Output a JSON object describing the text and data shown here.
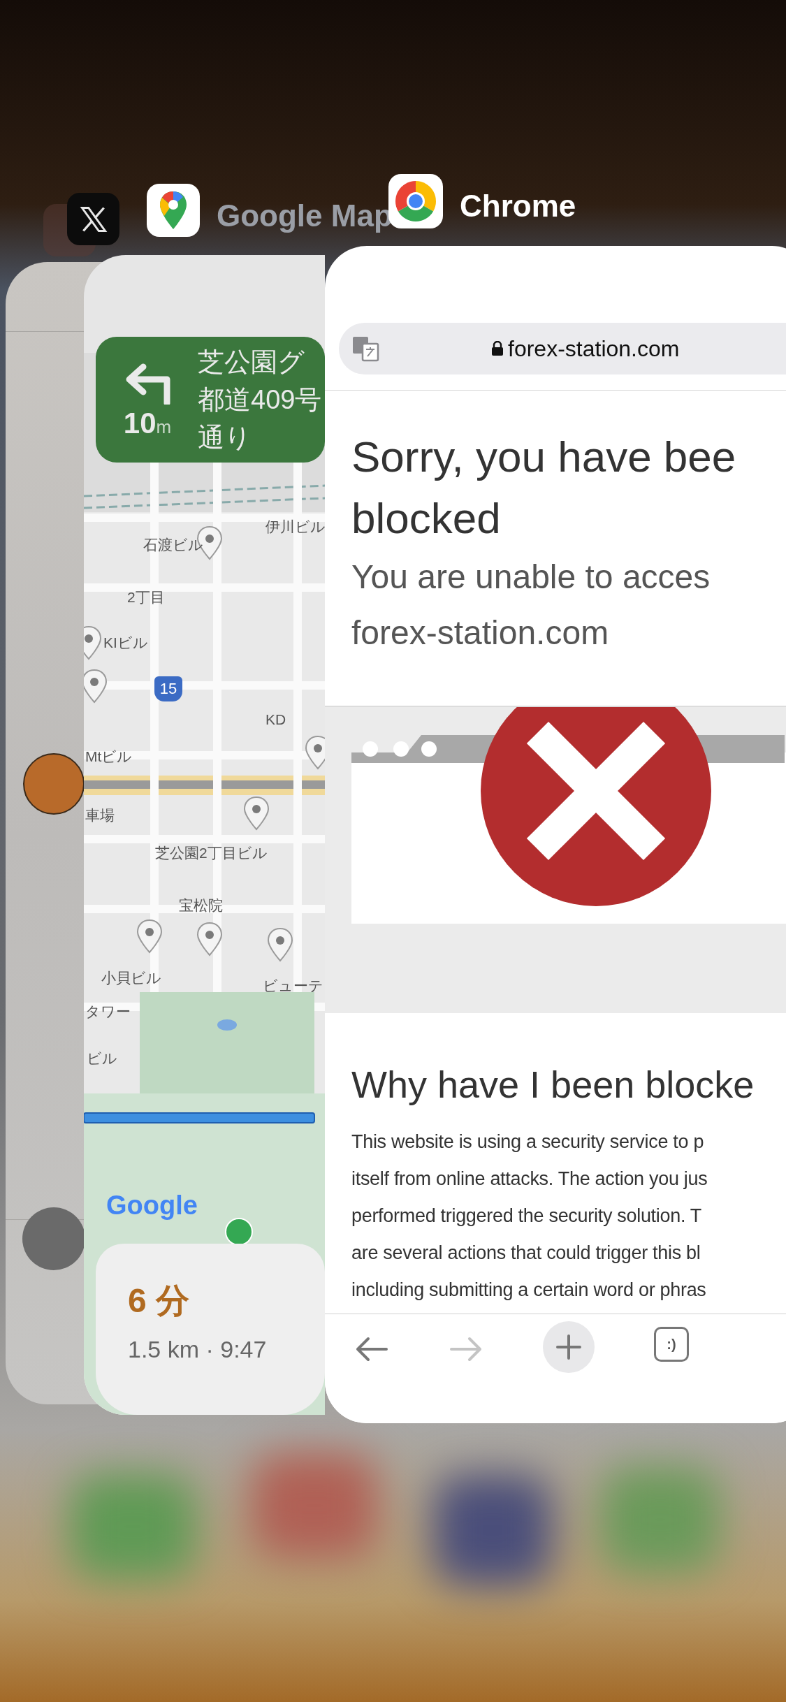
{
  "cards": [
    {
      "kind": "x"
    },
    {
      "kind": "maps",
      "label": "Google Map",
      "navigation": {
        "distance": "10",
        "unit": "m",
        "lines": [
          "芝公園グ",
          "都道409号",
          "通り"
        ]
      },
      "map_labels": [
        "伊川ビル",
        "石渡ビル",
        "2丁目",
        "KIビル",
        "Mtビル",
        "KD",
        "車場",
        "芝公園2丁目ビル",
        "宝松院",
        "小貝ビル",
        "ビューテ",
        "タワー",
        "ビル"
      ],
      "route_badge": "15",
      "map_logo": "Google",
      "trip": {
        "duration": "6 分",
        "details": "1.5 km · 9:47"
      }
    },
    {
      "kind": "chrome",
      "label": "Chrome",
      "url": "forex-station.com",
      "title_lines": [
        "Sorry, you have bee",
        "blocked"
      ],
      "subtitle_lines": [
        "You are unable to acces",
        "forex-station.com"
      ],
      "section_heading": "Why have I been blocke",
      "paragraph_lines": [
        "This website is using a security service to p",
        "itself from online attacks. The action you jus",
        "performed triggered the security solution. T",
        "are several actions that could trigger this bl",
        "including submitting a certain word or phras"
      ],
      "tab_count": ":)"
    }
  ]
}
